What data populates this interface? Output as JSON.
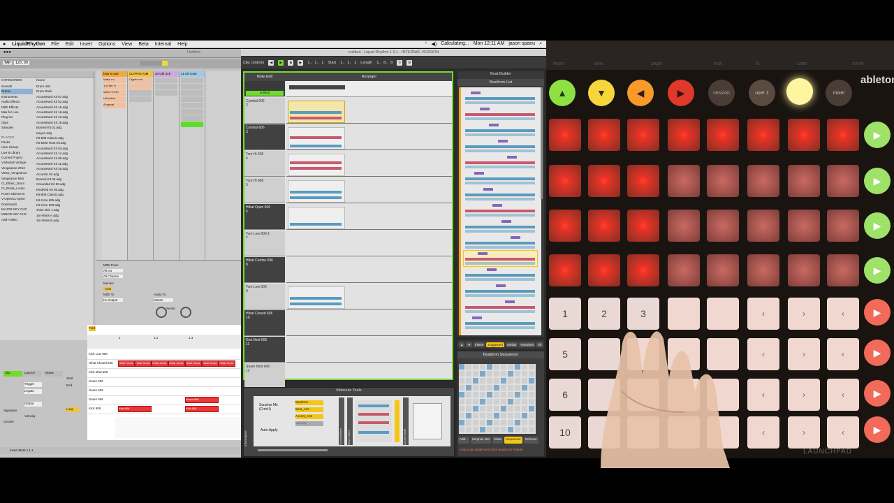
{
  "menubar": {
    "app": "LiquidRhythm",
    "items": [
      "File",
      "Edit",
      "Insert",
      "Options",
      "View",
      "Beta",
      "Internal",
      "Help"
    ],
    "status": "Calculating...",
    "clock": "Mon 12:11 AM",
    "user": "jason spanu"
  },
  "ableton": {
    "window_title": "Untitled",
    "tempo": "120.00",
    "browser": {
      "categories_header": "CATEGORIES",
      "name_header": "Name",
      "categories": [
        "Sounds",
        "Drums",
        "Instruments",
        "Audio Effects",
        "MIDI Effects",
        "Max for Live",
        "Plug-ins",
        "Clips",
        "Samples"
      ],
      "places_header": "PLACES",
      "places": [
        "Packs",
        "User Library",
        "Live 8 Library",
        "Current Project",
        "V-Module Vintage",
        "Vengeance 2013",
        "VEE2_Vengeance",
        "Vengeance Mini",
        "CI_Ethnic_Drum",
        "CI_Break_Loops",
        "PUSH Skinner B",
        "V-OpenGL-Open",
        "Downloads",
        "MAJOR KEY CHC",
        "MINOR KEY CHC",
        "Add Folder..."
      ],
      "files": [
        "Drum Hits",
        "Drum Rack",
        "AcoustHard Kit 07.adg",
        "AcoustHard Kit 02.adg",
        "AcoustHard Kit 15.adg",
        "AcoustHard Kit 16.adg",
        "AcoustHard Kit 10.adg",
        "AcoustHard Kit 19.adg",
        "Burned Kit 01.adg",
        "Ianyes.adg",
        "Kit-808 Classic.adg",
        "Kit-DMX Rust Kit.adg",
        "AcoustHard Kit 03.adg",
        "AcoustHard Kit 14.adg",
        "AcoustHard Kit 08.adg",
        "AcoustHard Kit 11.adg",
        "AcoustHard Kit 20.adg",
        "Acoustic Kit.adg",
        "Burned Kit 06.adg",
        "Grounded Kit 06.adg",
        "KindRed Kit 06.adg",
        "Kit-909 Classic.adg",
        "Kit-Core 606.adg",
        "Kit-Core 909.adg",
        "shine skin 1.adg",
        "16 Hihats A.adg",
        "16 Hihats B.adg"
      ]
    },
    "tracks": [
      {
        "name": "how to use",
        "num": "17"
      },
      {
        "name": "CLYPHX (UM",
        "num": "18"
      },
      {
        "name": "20 Old Sch",
        "num": "20"
      },
      {
        "name": "21 Kit-Core",
        "num": "21"
      }
    ],
    "clip_names": [
      "Make a c",
      "Clyphx run",
      "1 to the \"ri",
      "select \"CHC",
      "Hit button",
      "A repeat"
    ],
    "mixer": {
      "midi_from": "MIDI From",
      "all_ins": "All Ins",
      "all_channels": "All Channe",
      "monitor": "Monitor",
      "in": "In",
      "auto": "Auto",
      "off": "Off",
      "midi_to": "MIDI To",
      "audio_to": "Audio To",
      "no_output": "No Output",
      "master": "Master",
      "sends": "Sends"
    },
    "clip_view": {
      "clip_label": "Clip",
      "launch_label": "Launch",
      "notes_label": "Notes",
      "launch_mode": "Trigger",
      "quantization": "Global",
      "legato": "Legato",
      "loop": "Loop",
      "signature": "Signature",
      "groove": "Groove",
      "velocity": "Velocity",
      "start": "Start",
      "end": "End",
      "fold": "Fold"
    },
    "midi_lanes": [
      "Kick Low 606",
      "Hihat Closed 606",
      "Kick Mod 606",
      "Snare 606",
      "Snare 606",
      "Snare 606",
      "Kick 606"
    ],
    "midi_notes": [
      {
        "lane": 1,
        "start": 0,
        "label": "Hihat Close"
      },
      {
        "lane": 1,
        "start": 1,
        "label": "Hihat Close"
      },
      {
        "lane": 1,
        "start": 2,
        "label": "Hihat Close"
      },
      {
        "lane": 1,
        "start": 3,
        "label": "Hihat Close"
      },
      {
        "lane": 1,
        "start": 4,
        "label": "Hihat Close"
      },
      {
        "lane": 1,
        "start": 5,
        "label": "Hihat Close"
      },
      {
        "lane": 1,
        "start": 6,
        "label": "Hihat Close"
      },
      {
        "lane": 5,
        "start": 4,
        "label": "Snare 606"
      },
      {
        "lane": 6,
        "start": 0,
        "label": "Kick 606"
      },
      {
        "lane": 6,
        "start": 4,
        "label": "Kick 606"
      }
    ],
    "ruler": [
      "1",
      "1.2",
      "1.3"
    ],
    "status_text": "Insert Mark 1.1.1"
  },
  "lr": {
    "title": "untitled - Liquid Rhythm 1.3.1 - INTERNAL VERSION",
    "clip_controls": "Clip controls",
    "position": "1. 1. 1",
    "start_label": "Start",
    "start_val": "1. 1. 1",
    "length_label": "Length",
    "length_val": "1. 0. 0",
    "note_edit": "Note Edit",
    "arranger": "Arranger",
    "project": "untitled",
    "tracks": [
      {
        "name": "Cymbal 606",
        "num": "2",
        "dark": false
      },
      {
        "name": "Cymbal 606",
        "num": "3",
        "dark": true
      },
      {
        "name": "Tom Hi 606",
        "num": "4",
        "dark": false
      },
      {
        "name": "Tom Hi 606",
        "num": "5",
        "dark": false
      },
      {
        "name": "Hihat Open 606",
        "num": "6",
        "dark": true
      },
      {
        "name": "Tom Low 606-1",
        "num": "7",
        "dark": false
      },
      {
        "name": "Hihat Combo 606",
        "num": "8",
        "dark": true
      },
      {
        "name": "Tom Low 606",
        "num": "9",
        "dark": false
      },
      {
        "name": "Hihat Closed 606",
        "num": "10",
        "dark": true
      },
      {
        "name": "Kick Mod 606",
        "num": "11",
        "dark": true
      },
      {
        "name": "Snare Mod 606",
        "num": "12",
        "dark": false
      }
    ],
    "molecule_tools": "Molecule Tools",
    "surprise_me": "Surprise Me (Cmd-I)",
    "auto_apply": "Auto-Apply",
    "mol_params": [
      "Beatform",
      "Beat_Amt",
      "Accent_Amt",
      "Velocity"
    ],
    "side_labels": [
      "Information",
      "Randomizer",
      "Groove/Mixer",
      "Move Notes",
      "Accent Mode"
    ],
    "beat_builder": "Beat Builder",
    "beatform_list": "Beatform List",
    "filters": [
      "Filters",
      "Suggested",
      "Similar",
      "Favorites",
      "All"
    ],
    "beatform_sequencer": "Beatform Sequencer",
    "seq_buttons": [
      "Add...",
      "Surprise Me!",
      "Clear",
      "Sequencer",
      "Remove"
    ],
    "auto_load": "Auto-Load BeatForms from BeatForm Palette"
  },
  "launchpad": {
    "top_labels": [
      "learn",
      "view",
      "page",
      "inst",
      "fx",
      "user",
      "mixer"
    ],
    "top_buttons": [
      "up-arrow",
      "down-arrow",
      "left-arrow",
      "right-arrow",
      "session",
      "user 1",
      "user 2",
      "mixer"
    ],
    "num_pads": [
      "1",
      "2",
      "3",
      "",
      "5",
      "",
      "",
      "",
      "6",
      "",
      "",
      "",
      "10",
      "",
      "",
      ""
    ],
    "brand": "ableton",
    "brand2": "LAUNCHPAD"
  },
  "colors": {
    "lr_green": "#6fdc2e",
    "lr_yellow": "#f5c518",
    "lp_red": "#e83223",
    "lp_green": "#9ee26a"
  }
}
